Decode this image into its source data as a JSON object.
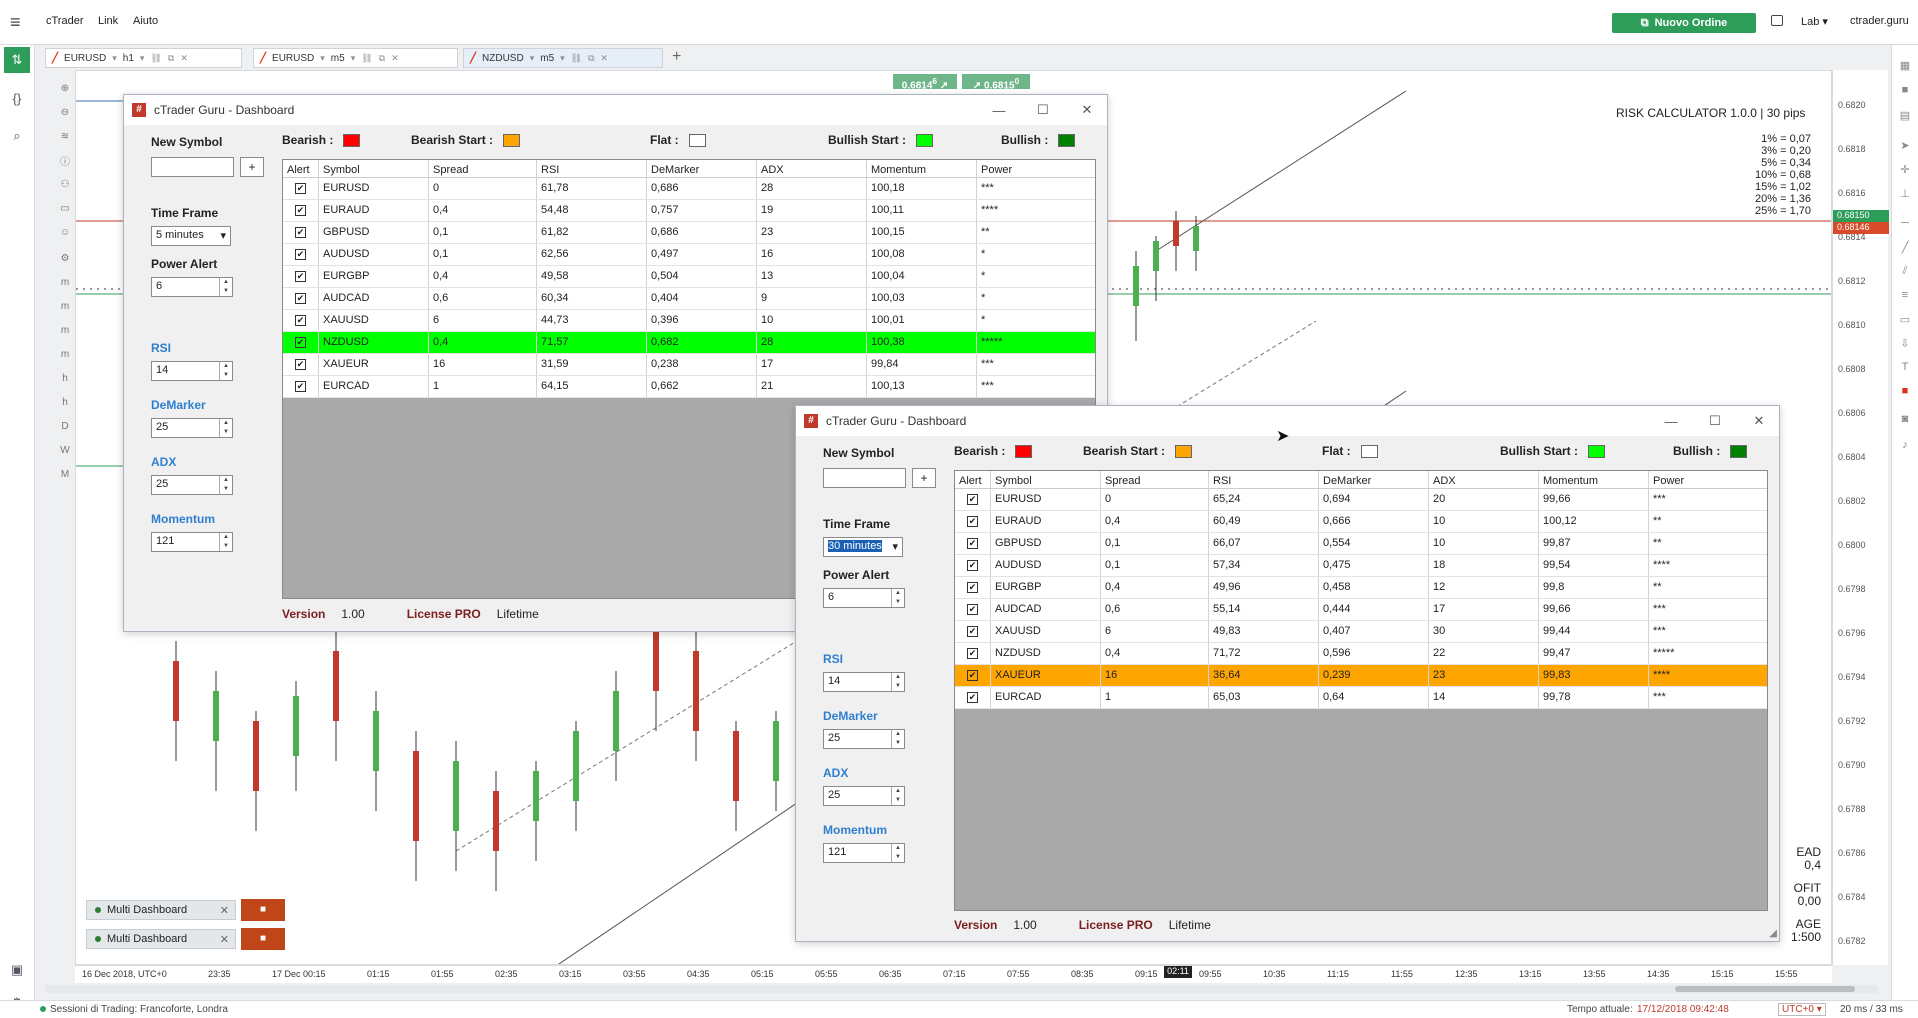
{
  "app": {
    "menu_icon": "hamburger-icon",
    "items": [
      "cTrader",
      "Link",
      "Aiuto"
    ],
    "new_order": "Nuovo Ordine",
    "lab": "Lab",
    "brand": "ctrader.guru"
  },
  "tabs": [
    {
      "symbol": "EURUSD",
      "timeframe": "h1"
    },
    {
      "symbol": "EURUSD",
      "timeframe": "m5"
    },
    {
      "symbol": "NZDUSD",
      "timeframe": "m5"
    }
  ],
  "quote": {
    "bid": "0.6814",
    "bid_sup": "6",
    "ask": "0.6815",
    "ask_sup": "0"
  },
  "risk": {
    "title": "RISK CALCULATOR 1.0.0 | 30 pips",
    "rows": [
      "1% = 0,07",
      "3% = 0,20",
      "5% = 0,34",
      "10% = 0,68",
      "15% = 1,02",
      "20% = 1,36",
      "25% = 1,70"
    ]
  },
  "overlay_right": [
    "EAD",
    "0,4",
    "OFIT",
    "0,00",
    "AGE",
    "1:500"
  ],
  "price_axis": [
    "0.6820",
    "0.6818",
    "0.6816",
    "0.6814",
    "0.6812",
    "0.6810",
    "0.6808",
    "0.6806",
    "0.6804",
    "0.6802",
    "0.6800",
    "0.6798",
    "0.6796",
    "0.6794",
    "0.6792",
    "0.6790",
    "0.6788",
    "0.6786",
    "0.6784",
    "0.6782"
  ],
  "price_tags": {
    "ask": "0.68150",
    "bid": "0.68146"
  },
  "time_axis": [
    "16 Dec 2018, UTC+0",
    "23:35",
    "17 Dec 00:15",
    "01:15",
    "01:55",
    "02:35",
    "03:15",
    "03:55",
    "04:35",
    "05:15",
    "05:55",
    "06:35",
    "07:15",
    "07:55",
    "08:35",
    "09:15",
    "09:55",
    "10:35",
    "11:15",
    "11:55",
    "12:35",
    "13:15",
    "13:55",
    "14:35",
    "15:15",
    "15:55"
  ],
  "time_cursor": "02:11",
  "multi_dashboard": [
    "Multi Dashboard",
    "Multi Dashboard"
  ],
  "status": {
    "sessions": "Sessioni di Trading:  Francoforte, Londra",
    "time_label": "Tempo attuale:",
    "time_value": "17/12/2018 09:42:48",
    "tz": "UTC+0",
    "latency": "20 ms / 33 ms"
  },
  "legend": {
    "bearish": "Bearish :",
    "bearish_start": "Bearish Start :",
    "flat": "Flat :",
    "bullish_start": "Bullish Start :",
    "bullish": "Bullish :"
  },
  "colors": {
    "bearish": "#ff0000",
    "bearish_start": "#ffa500",
    "flat": "#ffffff",
    "bullish_start": "#00ff00",
    "bullish": "#008000",
    "row_bull": "#00ff00",
    "row_bear": "#ffa500"
  },
  "columns": [
    "Alert",
    "Symbol",
    "Spread",
    "RSI",
    "DeMarker",
    "ADX",
    "Momentum",
    "Power"
  ],
  "dash1": {
    "title": "cTrader Guru - Dashboard",
    "new_symbol": "New Symbol",
    "plus": "+",
    "time_frame": "Time Frame",
    "tf_value": "5 minutes",
    "power_alert": "Power Alert",
    "power_value": "6",
    "rsi": "RSI",
    "rsi_value": "14",
    "demarker": "DeMarker",
    "demarker_value": "25",
    "adx": "ADX",
    "adx_value": "25",
    "momentum": "Momentum",
    "momentum_value": "121",
    "version_label": "Version",
    "version": "1.00",
    "license_label": "License PRO",
    "license": "Lifetime",
    "rows": [
      [
        "✔",
        "EURUSD",
        "0",
        "61,78",
        "0,686",
        "28",
        "100,18",
        "***"
      ],
      [
        "✔",
        "EURAUD",
        "0,4",
        "54,48",
        "0,757",
        "19",
        "100,11",
        "****"
      ],
      [
        "✔",
        "GBPUSD",
        "0,1",
        "61,82",
        "0,686",
        "23",
        "100,15",
        "**"
      ],
      [
        "✔",
        "AUDUSD",
        "0,1",
        "62,56",
        "0,497",
        "16",
        "100,08",
        "*"
      ],
      [
        "✔",
        "EURGBP",
        "0,4",
        "49,58",
        "0,504",
        "13",
        "100,04",
        "*"
      ],
      [
        "✔",
        "AUDCAD",
        "0,6",
        "60,34",
        "0,404",
        "9",
        "100,03",
        "*"
      ],
      [
        "✔",
        "XAUUSD",
        "6",
        "44,73",
        "0,396",
        "10",
        "100,01",
        "*"
      ],
      [
        "✔",
        "NZDUSD",
        "0,4",
        "71,57",
        "0,682",
        "28",
        "100,38",
        "*****"
      ],
      [
        "✔",
        "XAUEUR",
        "16",
        "31,59",
        "0,238",
        "17",
        "99,84",
        "***"
      ],
      [
        "✔",
        "EURCAD",
        "1",
        "64,15",
        "0,662",
        "21",
        "100,13",
        "***"
      ]
    ]
  },
  "dash2": {
    "title": "cTrader Guru - Dashboard",
    "new_symbol": "New Symbol",
    "plus": "+",
    "time_frame": "Time Frame",
    "tf_value": "30 minutes",
    "power_alert": "Power Alert",
    "power_value": "6",
    "rsi": "RSI",
    "rsi_value": "14",
    "demarker": "DeMarker",
    "demarker_value": "25",
    "adx": "ADX",
    "adx_value": "25",
    "momentum": "Momentum",
    "momentum_value": "121",
    "version_label": "Version",
    "version": "1.00",
    "license_label": "License PRO",
    "license": "Lifetime",
    "rows": [
      [
        "✔",
        "EURUSD",
        "0",
        "65,24",
        "0,694",
        "20",
        "99,66",
        "***"
      ],
      [
        "✔",
        "EURAUD",
        "0,4",
        "60,49",
        "0,666",
        "10",
        "100,12",
        "**"
      ],
      [
        "✔",
        "GBPUSD",
        "0,1",
        "66,07",
        "0,554",
        "10",
        "99,87",
        "**"
      ],
      [
        "✔",
        "AUDUSD",
        "0,1",
        "57,34",
        "0,475",
        "18",
        "99,54",
        "****"
      ],
      [
        "✔",
        "EURGBP",
        "0,4",
        "49,96",
        "0,458",
        "12",
        "99,8",
        "**"
      ],
      [
        "✔",
        "AUDCAD",
        "0,6",
        "55,14",
        "0,444",
        "17",
        "99,66",
        "***"
      ],
      [
        "✔",
        "XAUUSD",
        "6",
        "49,83",
        "0,407",
        "30",
        "99,44",
        "***"
      ],
      [
        "✔",
        "NZDUSD",
        "0,4",
        "71,72",
        "0,596",
        "22",
        "99,47",
        "*****"
      ],
      [
        "✔",
        "XAUEUR",
        "16",
        "36,64",
        "0,239",
        "23",
        "99,83",
        "****"
      ],
      [
        "✔",
        "EURCAD",
        "1",
        "65,03",
        "0,64",
        "14",
        "99,78",
        "***"
      ]
    ]
  }
}
